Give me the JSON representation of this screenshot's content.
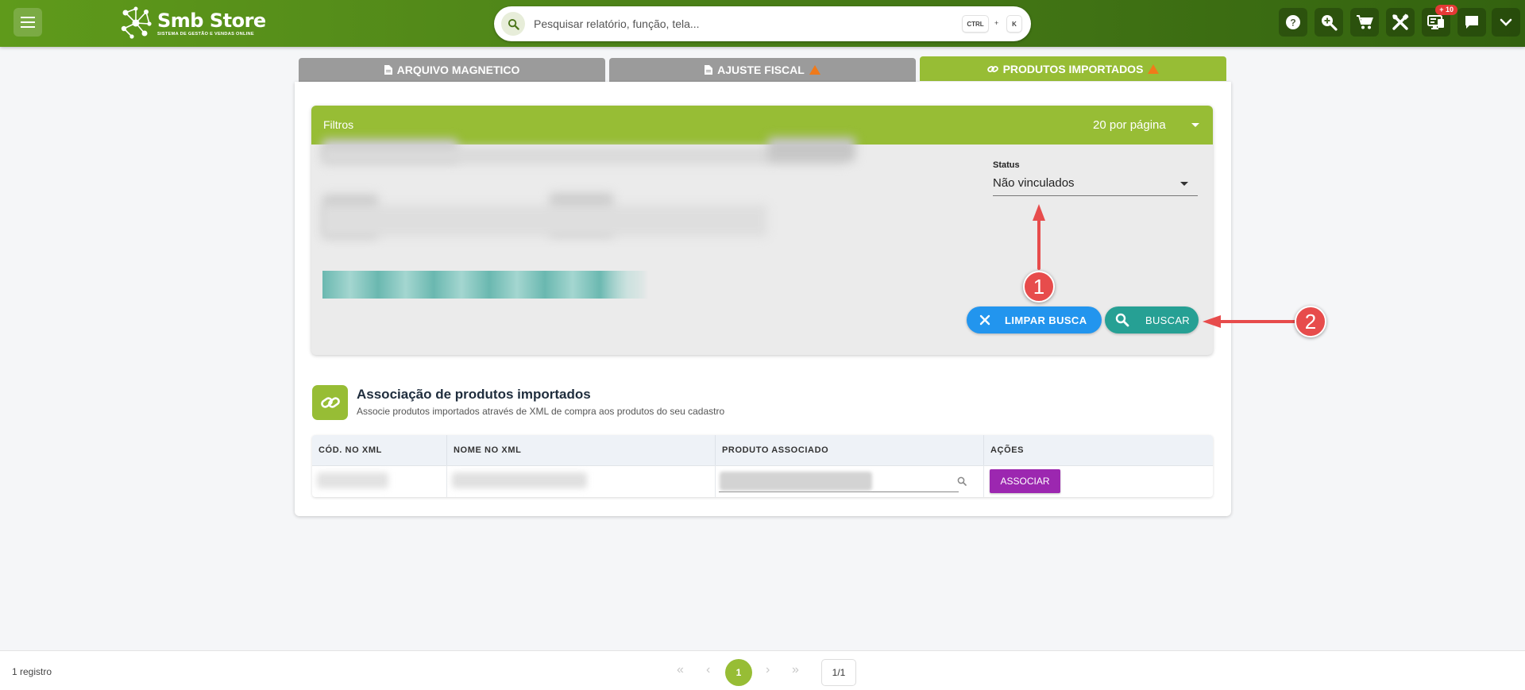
{
  "header": {
    "brand_name": "Smb Store",
    "brand_tagline": "SISTEMA DE GESTÃO E VENDAS ONLINE",
    "search_placeholder": "Pesquisar relatório, função, tela...",
    "shortcut_ctrl": "CTRL",
    "shortcut_plus": "+",
    "shortcut_key": "K",
    "icons": [
      "help-icon",
      "zoom-in-icon",
      "cart-icon",
      "tools-icon",
      "monitor-icon",
      "chat-icon",
      "chevron-down-icon"
    ],
    "notification_badge": "+ 10"
  },
  "tabs": [
    {
      "label": "ARQUIVO MAGNETICO",
      "active": false,
      "warning": false
    },
    {
      "label": "AJUSTE FISCAL",
      "active": false,
      "warning": true
    },
    {
      "label": "PRODUTOS IMPORTADOS",
      "active": true,
      "warning": true
    }
  ],
  "filters": {
    "title": "Filtros",
    "per_page": "20 por página",
    "status_label": "Status",
    "status_value": "Não vinculados",
    "clear_label": "LIMPAR BUSCA",
    "search_label": "BUSCAR"
  },
  "association": {
    "title": "Associação de produtos importados",
    "subtitle": "Associe produtos importados através de XML de compra aos produtos do seu cadastro",
    "columns": [
      "CÓD. NO XML",
      "NOME NO XML",
      "PRODUTO ASSOCIADO",
      "AÇÕES"
    ],
    "action_label": "ASSOCIAR"
  },
  "footer": {
    "records": "1 registro",
    "current_page": "1",
    "page_total": "1/1"
  },
  "annotations": {
    "marker_1": "1",
    "marker_2": "2",
    "color": "#e74c4c"
  },
  "colors": {
    "brand_green": "#97bd35",
    "header_green": "#4b8018",
    "clear_blue": "#2295ee",
    "search_teal": "#26a094",
    "associate_purple": "#9c27b0"
  }
}
